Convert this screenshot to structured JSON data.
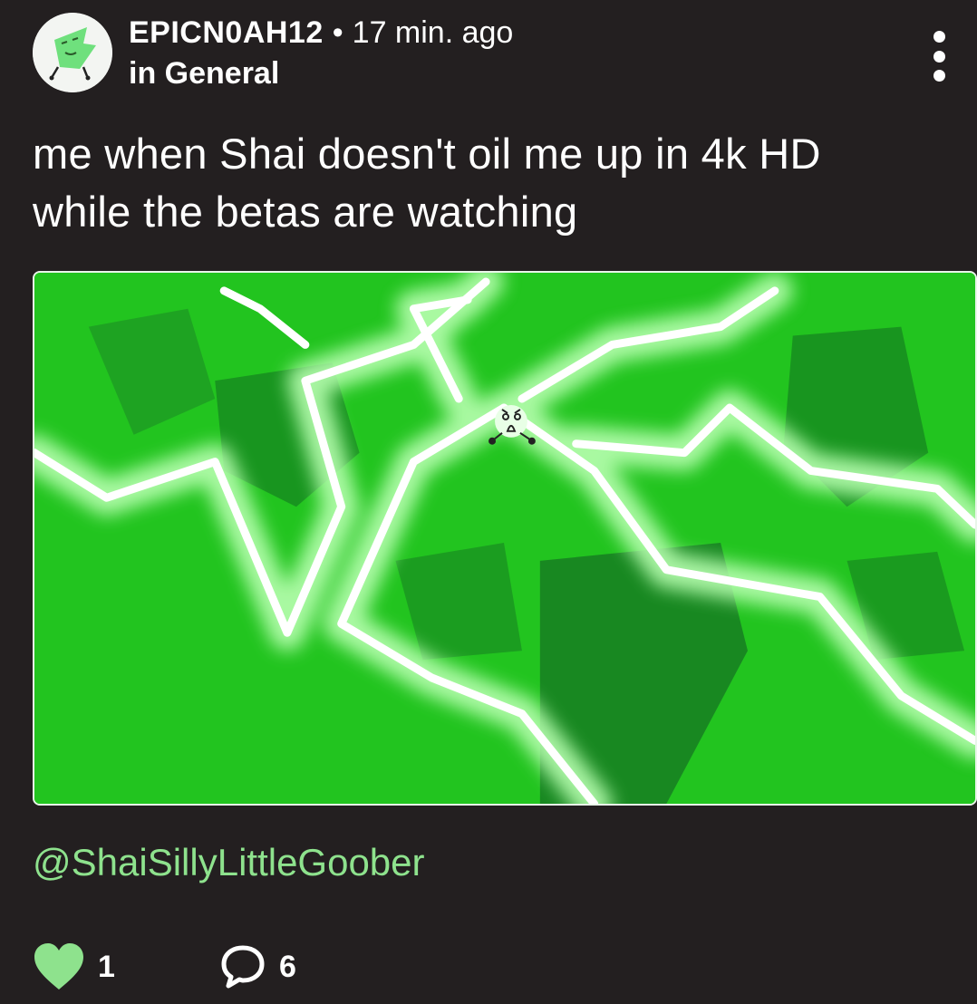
{
  "post": {
    "author": {
      "username": "EPICN0AH12",
      "separator": "•",
      "time_ago": "17 min. ago",
      "community": "in General"
    },
    "text_line1": "me when Shai doesn't oil me up in 4k HD",
    "text_line2": "while the betas are watching",
    "media": {
      "icon": "green-lightning-drawing"
    },
    "mention": "@ShaiSillyLittleGoober",
    "reactions": {
      "likes": "1",
      "comments": "6"
    }
  },
  "colors": {
    "background": "#231f20",
    "mention": "#8ee28d",
    "like_heart": "#8ee28d",
    "media_green": "#22c41f",
    "text": "#ffffff"
  },
  "icons": {
    "avatar": "green-leaf-character-avatar",
    "more": "vertical-ellipsis-icon",
    "like": "heart-icon",
    "comment": "speech-bubble-icon"
  }
}
